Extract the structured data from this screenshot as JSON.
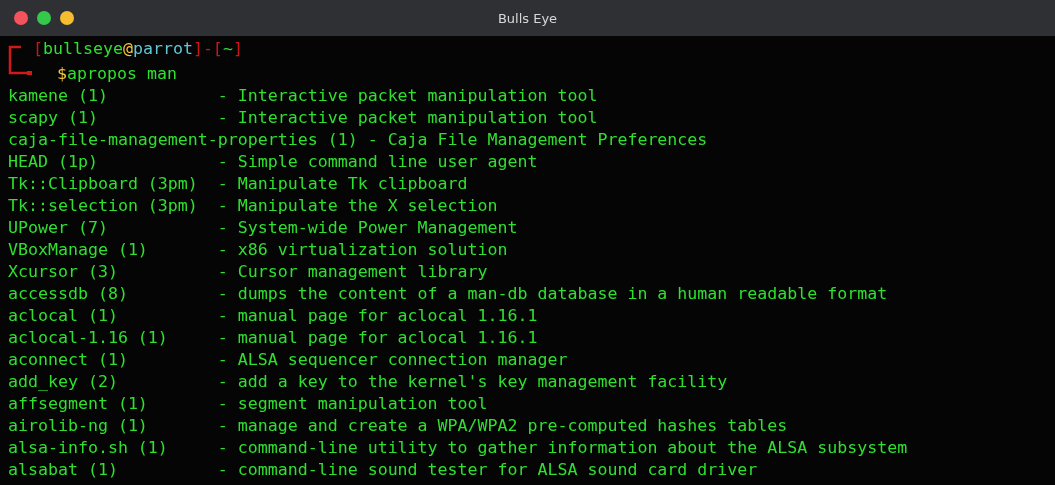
{
  "window": {
    "title": "Bulls Eye"
  },
  "prompt": {
    "open_bracket": "[",
    "user": "bullseye",
    "at": "@",
    "host": "parrot",
    "separator": "]-[",
    "cwd": "~",
    "close_bracket": "]",
    "symbol": "$",
    "command": "apropos man"
  },
  "output": [
    "kamene (1)           - Interactive packet manipulation tool",
    "scapy (1)            - Interactive packet manipulation tool",
    "caja-file-management-properties (1) - Caja File Management Preferences",
    "HEAD (1p)            - Simple command line user agent",
    "Tk::Clipboard (3pm)  - Manipulate Tk clipboard",
    "Tk::selection (3pm)  - Manipulate the X selection",
    "UPower (7)           - System-wide Power Management",
    "VBoxManage (1)       - x86 virtualization solution",
    "Xcursor (3)          - Cursor management library",
    "accessdb (8)         - dumps the content of a man-db database in a human readable format",
    "aclocal (1)          - manual page for aclocal 1.16.1",
    "aclocal-1.16 (1)     - manual page for aclocal 1.16.1",
    "aconnect (1)         - ALSA sequencer connection manager",
    "add_key (2)          - add a key to the kernel's key management facility",
    "affsegment (1)       - segment manipulation tool",
    "airolib-ng (1)       - manage and create a WPA/WPA2 pre-computed hashes tables",
    "alsa-info.sh (1)     - command-line utility to gather information about the ALSA subsystem",
    "alsabat (1)          - command-line sound tester for ALSA sound card driver"
  ]
}
